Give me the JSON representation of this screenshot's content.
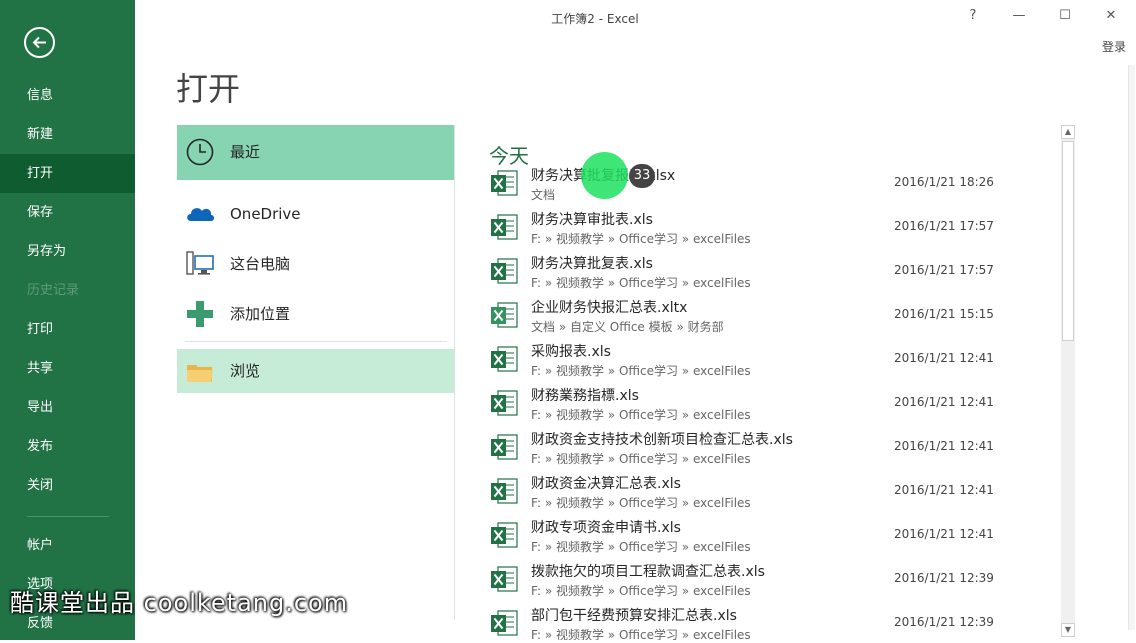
{
  "window": {
    "title": "工作簿2 - Excel",
    "help": "?",
    "minimize": "—",
    "maximize": "☐",
    "close": "✕",
    "sign_in": "登录"
  },
  "nav": {
    "items": [
      {
        "label": "信息",
        "state": "normal"
      },
      {
        "label": "新建",
        "state": "normal"
      },
      {
        "label": "打开",
        "state": "active"
      },
      {
        "label": "保存",
        "state": "normal"
      },
      {
        "label": "另存为",
        "state": "normal"
      },
      {
        "label": "历史记录",
        "state": "disabled"
      },
      {
        "label": "打印",
        "state": "normal"
      },
      {
        "label": "共享",
        "state": "normal"
      },
      {
        "label": "导出",
        "state": "normal"
      },
      {
        "label": "发布",
        "state": "normal"
      },
      {
        "label": "关闭",
        "state": "normal"
      },
      {
        "label": "帐户",
        "state": "normal"
      },
      {
        "label": "选项",
        "state": "normal"
      },
      {
        "label": "反馈",
        "state": "normal"
      }
    ]
  },
  "page": {
    "title": "打开"
  },
  "places": {
    "recent": "最近",
    "onedrive": "OneDrive",
    "computer": "这台电脑",
    "add": "添加位置",
    "browse": "浏览"
  },
  "recent": {
    "section": "今天",
    "files": [
      {
        "name": "财务决算批复报表.xlsx",
        "path": "文档",
        "date": "2016/1/21 18:26"
      },
      {
        "name": "财务决算审批表.xls",
        "path": "F: » 视频教学 » Office学习 » excelFiles",
        "date": "2016/1/21 17:57"
      },
      {
        "name": "财务决算批复表.xls",
        "path": "F: » 视频教学 » Office学习 » excelFiles",
        "date": "2016/1/21 17:57"
      },
      {
        "name": "企业财务快报汇总表.xltx",
        "path": "文档 » 自定义 Office 模板 » 财务部",
        "date": "2016/1/21 15:15"
      },
      {
        "name": "采购报表.xls",
        "path": "F: » 视频教学 » Office学习 » excelFiles",
        "date": "2016/1/21 12:41"
      },
      {
        "name": "财務業務指標.xls",
        "path": "F: » 视频教学 » Office学习 » excelFiles",
        "date": "2016/1/21 12:41"
      },
      {
        "name": "财政资金支持技术创新项目检查汇总表.xls",
        "path": "F: » 视频教学 » Office学习 » excelFiles",
        "date": "2016/1/21 12:41"
      },
      {
        "name": "财政资金决算汇总表.xls",
        "path": "F: » 视频教学 » Office学习 » excelFiles",
        "date": "2016/1/21 12:41"
      },
      {
        "name": "财政专项资金申请书.xls",
        "path": "F: » 视频教学 » Office学习 » excelFiles",
        "date": "2016/1/21 12:41"
      },
      {
        "name": "拨款拖欠的项目工程款调查汇总表.xls",
        "path": "F: » 视频教学 » Office学习 » excelFiles",
        "date": "2016/1/21 12:39"
      },
      {
        "name": "部门包干经费预算安排汇总表.xls",
        "path": "F: » 视频教学 » Office学习 » excelFiles",
        "date": "2016/1/21 12:39"
      }
    ]
  },
  "overlay": {
    "click_count": "33"
  },
  "watermark": "酷课堂出品 coolketang.com",
  "colors": {
    "accent": "#217346",
    "active_nav": "#0e5c2f",
    "recent_bg": "#87d4b2",
    "browse_bg": "#c6ecd8"
  }
}
